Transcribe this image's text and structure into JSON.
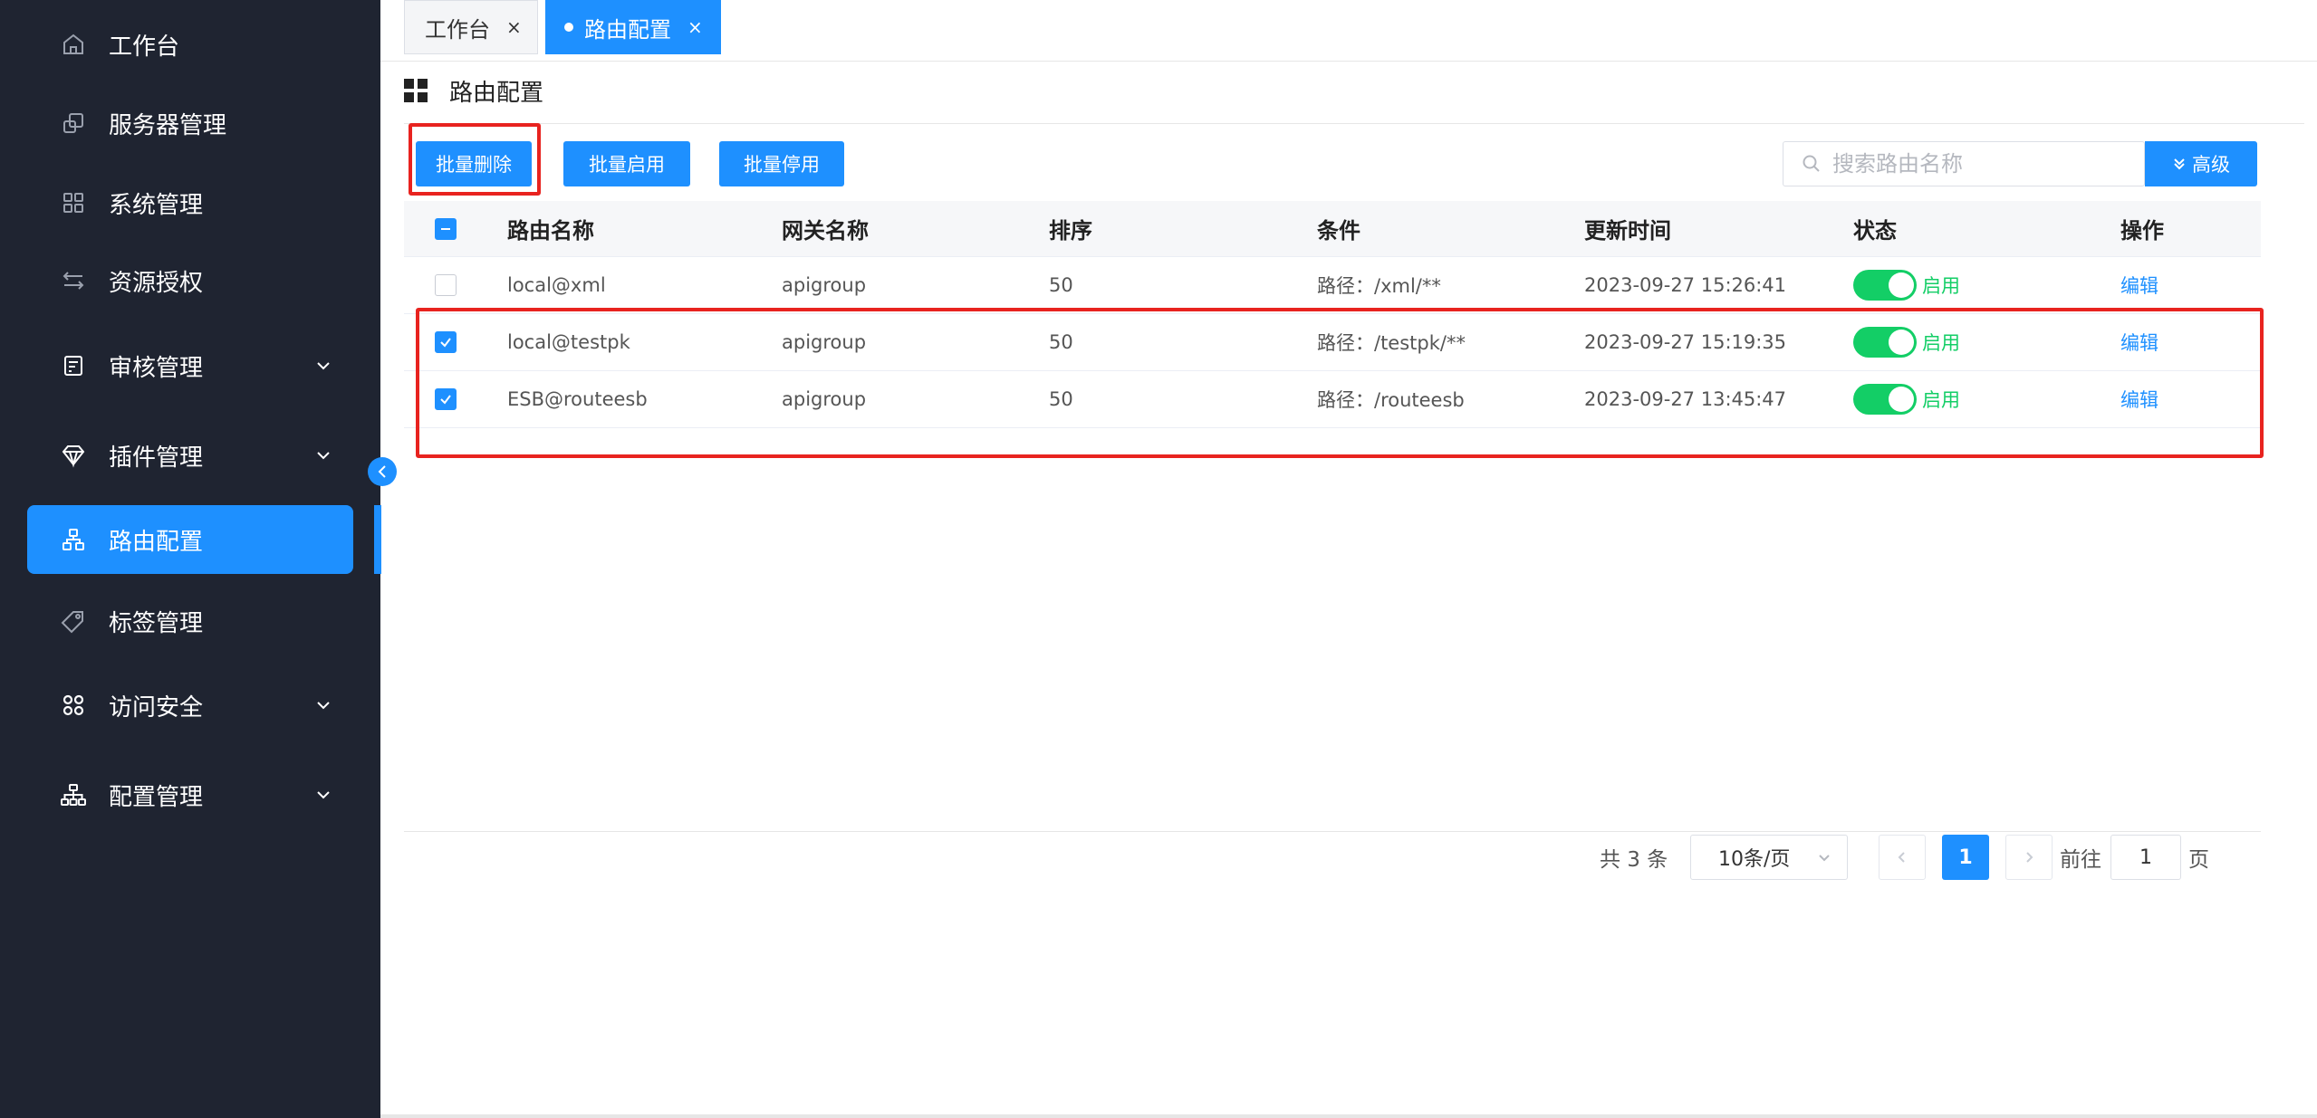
{
  "sidebar": {
    "items": [
      {
        "label": "工作台",
        "icon": "home-icon",
        "expandable": false
      },
      {
        "label": "服务器管理",
        "icon": "server-icon",
        "expandable": false
      },
      {
        "label": "系统管理",
        "icon": "grid-icon",
        "expandable": false
      },
      {
        "label": "资源授权",
        "icon": "swap-icon",
        "expandable": false
      },
      {
        "label": "审核管理",
        "icon": "audit-icon",
        "expandable": true
      },
      {
        "label": "插件管理",
        "icon": "diamond-icon",
        "expandable": true
      },
      {
        "label": "路由配置",
        "icon": "route-icon",
        "expandable": false,
        "active": true
      },
      {
        "label": "标签管理",
        "icon": "tag-icon",
        "expandable": false
      },
      {
        "label": "访问安全",
        "icon": "apps-icon",
        "expandable": true
      },
      {
        "label": "配置管理",
        "icon": "tree-icon",
        "expandable": true
      }
    ]
  },
  "tabs": [
    {
      "label": "工作台",
      "close": "×"
    },
    {
      "label": "路由配置",
      "close": "×",
      "active": true
    }
  ],
  "page": {
    "title": "路由配置"
  },
  "toolbar": {
    "batch_delete": "批量删除",
    "batch_enable": "批量启用",
    "batch_disable": "批量停用",
    "search_placeholder": "搜索路由名称",
    "advanced": "高级"
  },
  "table": {
    "headers": {
      "name": "路由名称",
      "gateway": "网关名称",
      "order": "排序",
      "condition": "条件",
      "updated": "更新时间",
      "status": "状态",
      "action": "操作"
    },
    "rows": [
      {
        "name": "local@xml",
        "gateway": "apigroup",
        "order": "50",
        "condition": "路径：/xml/**",
        "updated": "2023-09-27 15:26:41",
        "status": "启用",
        "action": "编辑",
        "checked": false
      },
      {
        "name": "local@testpk",
        "gateway": "apigroup",
        "order": "50",
        "condition": "路径：/testpk/**",
        "updated": "2023-09-27 15:19:35",
        "status": "启用",
        "action": "编辑",
        "checked": true
      },
      {
        "name": "ESB@routeesb",
        "gateway": "apigroup",
        "order": "50",
        "condition": "路径：/routeesb",
        "updated": "2023-09-27 13:45:47",
        "status": "启用",
        "action": "编辑",
        "checked": true
      }
    ]
  },
  "pagination": {
    "total": "共 3 条",
    "page_size": "10条/页",
    "current_page": "1",
    "goto_prefix": "前往",
    "goto_value": "1",
    "goto_suffix": "页"
  },
  "colors": {
    "primary": "#1e90ff",
    "sidebar_bg": "#1f2431",
    "switch_on": "#13ce66",
    "highlight": "#e8231f"
  }
}
